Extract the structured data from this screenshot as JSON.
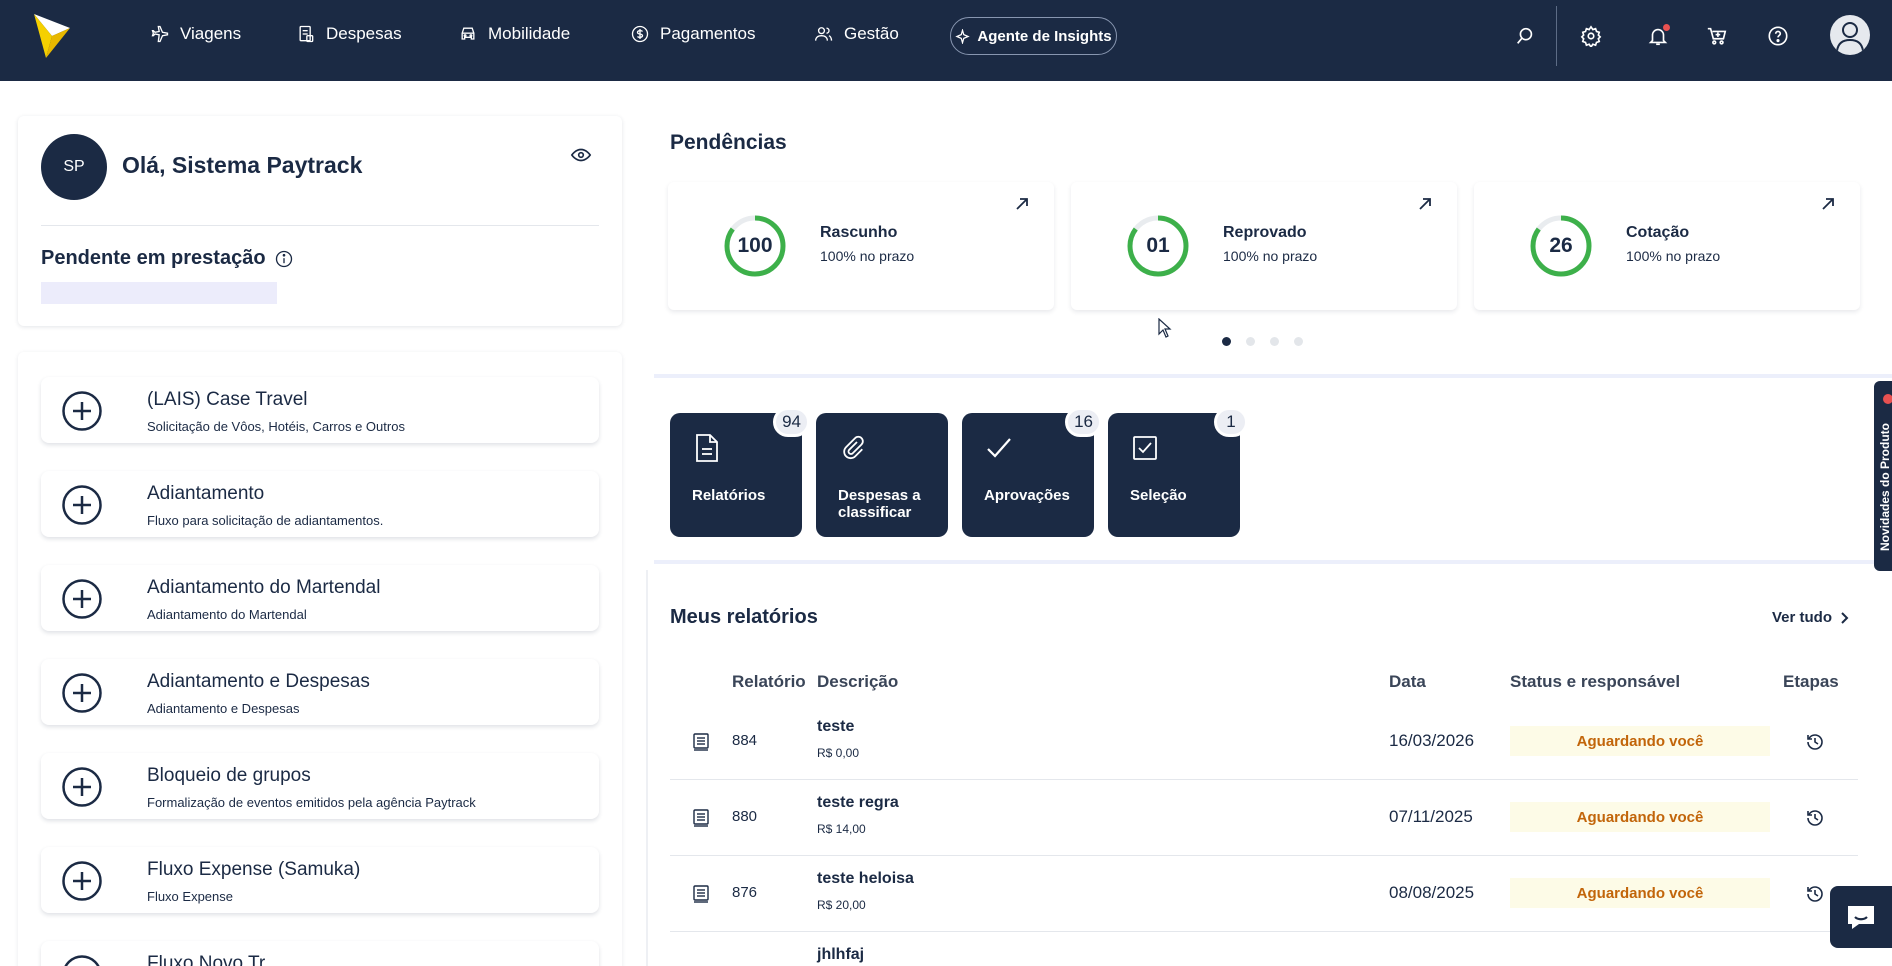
{
  "nav": {
    "items": [
      {
        "label": "Viagens",
        "icon": "airplane-icon"
      },
      {
        "label": "Despesas",
        "icon": "receipt-icon"
      },
      {
        "label": "Mobilidade",
        "icon": "car-icon"
      },
      {
        "label": "Pagamentos",
        "icon": "dollar-coin-icon"
      },
      {
        "label": "Gestão",
        "icon": "users-icon"
      }
    ],
    "insights_label": "Agente de Insights"
  },
  "greeting": {
    "initials": "SP",
    "title": "Olá, Sistema Paytrack",
    "pending_label": "Pendente em prestação"
  },
  "flows": [
    {
      "title": "(LAIS) Case Travel",
      "subtitle": "Solicitação de Vôos, Hotéis, Carros e Outros"
    },
    {
      "title": "Adiantamento",
      "subtitle": "Fluxo para solicitação de adiantamentos."
    },
    {
      "title": "Adiantamento do Martendal",
      "subtitle": "Adiantamento do Martendal"
    },
    {
      "title": "Adiantamento e Despesas",
      "subtitle": "Adiantamento e Despesas"
    },
    {
      "title": "Bloqueio de grupos",
      "subtitle": "Formalização de eventos emitidos pela agência Paytrack"
    },
    {
      "title": "Fluxo Expense (Samuka)",
      "subtitle": "Fluxo Expense"
    },
    {
      "title": "Fluxo Novo Tr",
      "subtitle": ""
    }
  ],
  "pendencias": {
    "title": "Pendências",
    "cards": [
      {
        "value": "100",
        "name": "Rascunho",
        "sub": "100% no prazo"
      },
      {
        "value": "01",
        "name": "Reprovado",
        "sub": "100% no prazo"
      },
      {
        "value": "26",
        "name": "Cotação",
        "sub": "100% no prazo"
      }
    ]
  },
  "shortcuts": [
    {
      "label": "Relatórios",
      "badge": "94",
      "icon": "document-icon"
    },
    {
      "label": "Despesas a classificar",
      "badge": "",
      "icon": "paperclip-icon"
    },
    {
      "label": "Aprovações",
      "badge": "16",
      "icon": "checkmark-icon"
    },
    {
      "label": "Seleção",
      "badge": "1",
      "icon": "checkbox-icon"
    }
  ],
  "reports": {
    "title": "Meus relatórios",
    "see_all": "Ver tudo",
    "headers": {
      "report": "Relatório",
      "description": "Descrição",
      "date": "Data",
      "status": "Status e responsável",
      "steps": "Etapas"
    },
    "rows": [
      {
        "num": "884",
        "desc": "teste",
        "amount": "R$ 0,00",
        "date": "16/03/2026",
        "status": "Aguardando você"
      },
      {
        "num": "880",
        "desc": "teste regra",
        "amount": "R$ 14,00",
        "date": "07/11/2025",
        "status": "Aguardando você"
      },
      {
        "num": "876",
        "desc": "teste heloisa",
        "amount": "R$ 20,00",
        "date": "08/08/2025",
        "status": "Aguardando você"
      },
      {
        "num": "",
        "desc": "jhlhfaj",
        "amount": "",
        "date": "",
        "status": ""
      }
    ]
  },
  "side_tab_label": "Novidades do Produto",
  "colors": {
    "navy": "#1b2a44",
    "ring_green": "#3db04a",
    "status_text": "#c2650a",
    "status_bg": "#fdfbe7"
  }
}
